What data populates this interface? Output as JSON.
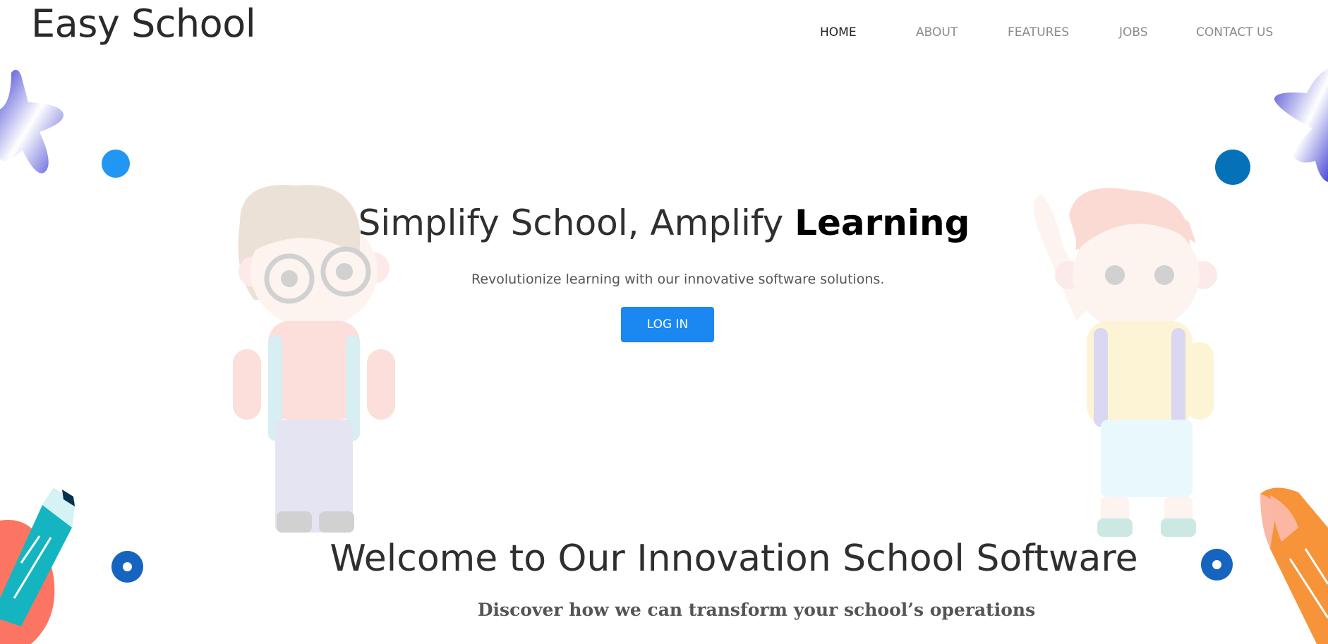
{
  "header": {
    "brand": "Easy School"
  },
  "nav": {
    "items": [
      {
        "label": "HOME",
        "active": true
      },
      {
        "label": "ABOUT"
      },
      {
        "label": "FEATURES"
      },
      {
        "label": "JOBS"
      },
      {
        "label": "CONTACT US"
      }
    ]
  },
  "hero": {
    "title_prefix": "Simplify School, Amplify",
    "title_bold": "Learning",
    "subtitle": "Revolutionize learning with our innovative software solutions.",
    "login_label": "LOG IN"
  },
  "welcome": {
    "title": "Welcome to Our Innovation School Software",
    "subtitle": "Discover how we can transform your school’s operations"
  },
  "colors": {
    "accent_blue": "#1a88f0",
    "dark_blue_dot": "#0f6cbf",
    "star_purple": "#5b5be0",
    "pencil_teal": "#1bb6c1",
    "pencil_orange": "#f7943a"
  },
  "icons": [
    "star-shape-icon",
    "circle-dot-icon",
    "pencil-icon",
    "ring-dot-icon",
    "girl-illustration",
    "boy-illustration"
  ]
}
